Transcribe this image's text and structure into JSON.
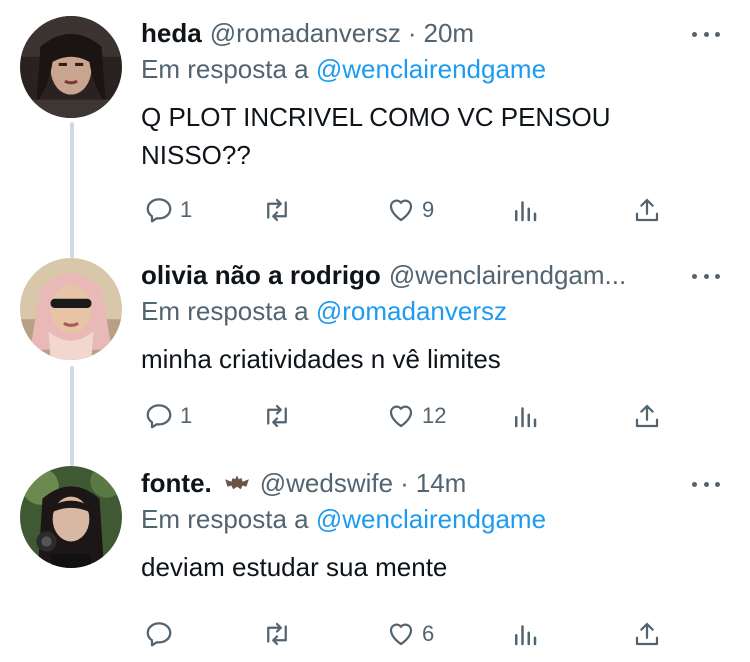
{
  "tweets": [
    {
      "name": "heda",
      "handle": "@romadanversz",
      "separator": "·",
      "time": "20m",
      "reply_prefix": "Em resposta a",
      "reply_handle": "@wenclairendgame",
      "text": "Q PLOT INCRIVEL COMO VC PENSOU NISSO??",
      "replies": "1",
      "retweets": "",
      "likes": "9"
    },
    {
      "name": "olivia não a rodrigo",
      "handle": "@wenclairendgam...",
      "separator": "",
      "time": "",
      "reply_prefix": "Em resposta a",
      "reply_handle": "@romadanversz",
      "text": "minha criatividades n vê limites",
      "replies": "1",
      "retweets": "",
      "likes": "12"
    },
    {
      "name": "fonte.",
      "name_emoji": "bat-emoji",
      "handle": "@wedswife",
      "separator": "·",
      "time": "14m",
      "reply_prefix": "Em resposta a",
      "reply_handle": "@wenclairendgame",
      "text": "deviam estudar sua mente",
      "replies": "",
      "retweets": "",
      "likes": "6"
    }
  ],
  "icons": [
    "reply-icon",
    "retweet-icon",
    "like-icon",
    "analytics-icon",
    "share-icon",
    "more-icon"
  ],
  "colors": {
    "link": "#1d9bf0",
    "muted": "#536471",
    "text": "#0f1419",
    "thread_line": "#cfd9de"
  }
}
